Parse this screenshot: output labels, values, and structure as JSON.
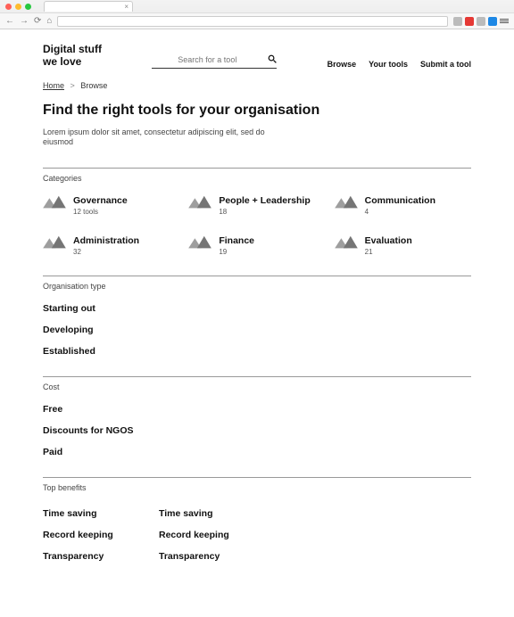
{
  "chrome": {
    "tab_close": "×"
  },
  "site": {
    "title_line1": "Digital stuff",
    "title_line2": "we love"
  },
  "search": {
    "placeholder": "Search for a tool"
  },
  "nav": {
    "browse": "Browse",
    "your_tools": "Your tools",
    "submit": "Submit a tool"
  },
  "breadcrumb": {
    "home": "Home",
    "sep": ">",
    "current": "Browse"
  },
  "page": {
    "title": "Find the right tools for your organisation",
    "desc": "Lorem ipsum dolor sit amet, consectetur adipiscing elit, sed do eiusmod"
  },
  "sections": {
    "categories": {
      "label": "Categories",
      "items": [
        {
          "name": "Governance",
          "count": "12 tools"
        },
        {
          "name": "People + Leadership",
          "count": "18"
        },
        {
          "name": "Communication",
          "count": "4"
        },
        {
          "name": "Administration",
          "count": "32"
        },
        {
          "name": "Finance",
          "count": "19"
        },
        {
          "name": "Evaluation",
          "count": "21"
        }
      ]
    },
    "org_type": {
      "label": "Organisation type",
      "items": [
        "Starting out",
        "Developing",
        "Established"
      ]
    },
    "cost": {
      "label": "Cost",
      "items": [
        "Free",
        "Discounts for NGOS",
        "Paid"
      ]
    },
    "benefits": {
      "label": "Top benefits",
      "col1": [
        "Time saving",
        "Record keeping",
        "Transparency"
      ],
      "col2": [
        "Time saving",
        "Record keeping",
        "Transparency"
      ]
    }
  }
}
